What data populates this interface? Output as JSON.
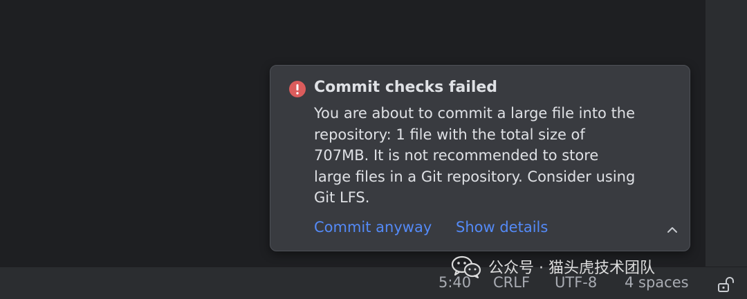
{
  "notification": {
    "title": "Commit checks failed",
    "message": "You are about to commit a large file into the repository: 1 file with the total size of 707MB. It is not recommended to store large files in a Git repository. Consider using Git LFS.",
    "actions": [
      "Commit anyway",
      "Show details"
    ],
    "icon": "error-icon",
    "collapse_icon": "chevron-up-icon",
    "accent_color": "#548af7",
    "error_color": "#db5c5c"
  },
  "status_bar": {
    "caret_position": "5:40",
    "line_separator": "CRLF",
    "encoding": "UTF-8",
    "indent": "4 spaces",
    "lock_icon": "unlock-icon"
  },
  "watermark": {
    "text": "公众号 · 猫头虎技术团队",
    "icon": "wechat-icon"
  }
}
